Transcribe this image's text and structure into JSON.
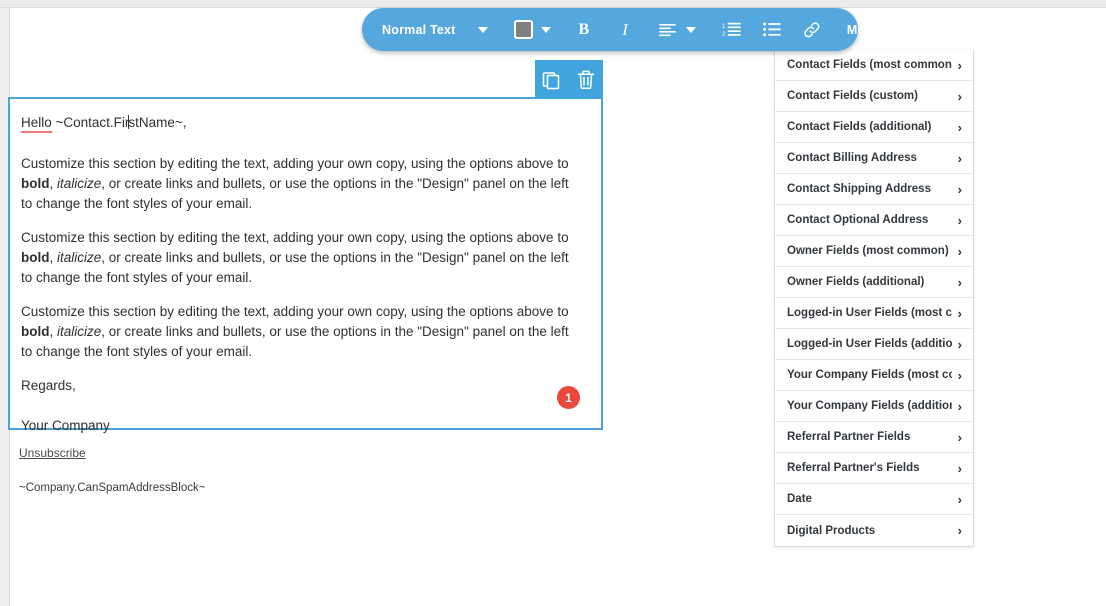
{
  "toolbar": {
    "style_label": "Normal Text",
    "color_swatch": "#808080",
    "bold_label": "B",
    "italic_label": "I",
    "merge_label": "Merge",
    "icons": {
      "style_caret": "chevron-down-icon",
      "color_caret": "chevron-down-icon",
      "align": "align-left-icon",
      "align_caret": "chevron-down-icon",
      "numbered_list": "numbered-list-icon",
      "bulleted_list": "bulleted-list-icon",
      "link": "link-icon",
      "merge_caret": "chevron-down-icon"
    }
  },
  "block_actions": {
    "duplicate": "duplicate-icon",
    "delete": "trash-icon"
  },
  "email": {
    "greeting_prefix": "Hello",
    "greeting_merge_pre": " ~Contact.Fir",
    "greeting_merge_post": "stName~,",
    "paragraphs": [
      {
        "part1": "Customize this section by editing the text, adding your own copy, using the options above to ",
        "bold": "bold",
        "part2": ", ",
        "italic": "italicize",
        "part3": ", or create links and bullets, or use the options in the \"Design\" panel on the left to change the font styles of your email."
      },
      {
        "part1": "Customize this section by editing the text, adding your own copy, using the options above to ",
        "bold": "bold",
        "part2": ", ",
        "italic": "italicize",
        "part3": ", or create links and bullets, or use the options in the \"Design\" panel on the left to change the font styles of your email."
      },
      {
        "part1": "Customize this section by editing the text, adding your own copy, using the options above to ",
        "bold": "bold",
        "part2": ", ",
        "italic": "italicize",
        "part3": ", or create links and bullets, or use the options in the \"Design\" panel on the left to change the font styles of your email."
      }
    ],
    "signoff": "Regards,",
    "company": "Your Company"
  },
  "badge": {
    "count": "1",
    "color": "#e8493a"
  },
  "footer": {
    "unsubscribe": "Unsubscribe",
    "canspam": "~Company.CanSpamAddressBlock~"
  },
  "merge_menu": {
    "items": [
      {
        "label": "Contact Fields (most common)",
        "chevron": "›"
      },
      {
        "label": "Contact Fields (custom)",
        "chevron": "›"
      },
      {
        "label": "Contact Fields (additional)",
        "chevron": "›"
      },
      {
        "label": "Contact Billing Address",
        "chevron": "›"
      },
      {
        "label": "Contact Shipping Address",
        "chevron": "›"
      },
      {
        "label": "Contact Optional Address",
        "chevron": "›"
      },
      {
        "label": "Owner Fields (most common)",
        "chevron": "›"
      },
      {
        "label": "Owner Fields (additional)",
        "chevron": "›"
      },
      {
        "label": "Logged-in User Fields (most com..",
        "chevron": "›"
      },
      {
        "label": "Logged-in User Fields (additional)",
        "chevron": "›"
      },
      {
        "label": "Your Company Fields (most com..",
        "chevron": "›"
      },
      {
        "label": "Your Company Fields (additional)",
        "chevron": "›"
      },
      {
        "label": "Referral Partner Fields",
        "chevron": "›"
      },
      {
        "label": "Referral Partner's Fields",
        "chevron": "›"
      },
      {
        "label": "Date",
        "chevron": "›"
      },
      {
        "label": "Digital Products",
        "chevron": "›"
      }
    ]
  },
  "colors": {
    "accent_blue": "#55a8dd",
    "block_border": "#4ba3dd",
    "badge_red": "#e8493a",
    "spell_error": "#f07a7a"
  }
}
